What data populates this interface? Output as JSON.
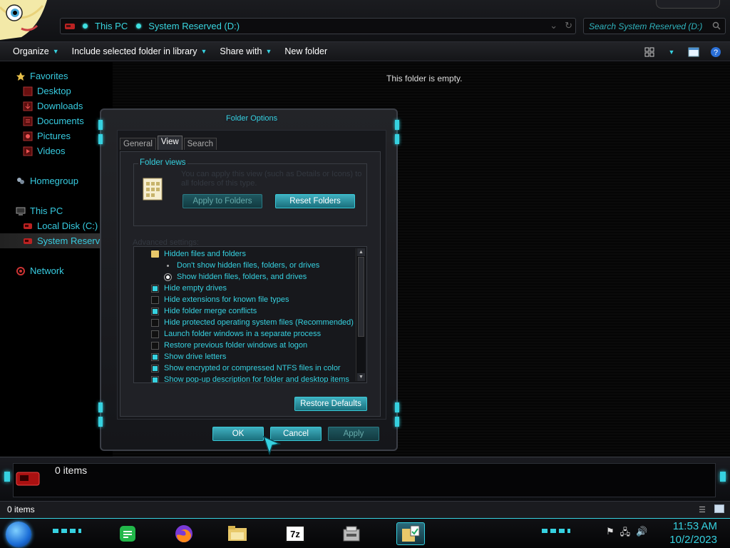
{
  "address": {
    "crumbs": [
      "This PC",
      "System Reserved (D:)"
    ],
    "search_placeholder": "Search System Reserved (D:)"
  },
  "toolbar": {
    "organize": "Organize",
    "include": "Include selected folder in library",
    "share": "Share with",
    "new_folder": "New folder"
  },
  "nav": {
    "favorites": "Favorites",
    "desktop": "Desktop",
    "downloads": "Downloads",
    "documents": "Documents",
    "pictures": "Pictures",
    "videos": "Videos",
    "homegroup": "Homegroup",
    "this_pc": "This PC",
    "local_disk": "Local Disk (C:)",
    "system_reserved": "System Reserve",
    "network": "Network"
  },
  "content": {
    "empty_message": "This folder is empty."
  },
  "details": {
    "item_count": "0 items"
  },
  "status": {
    "item_count": "0 items"
  },
  "dialog": {
    "title": "Folder Options",
    "tabs": [
      "General",
      "View",
      "Search"
    ],
    "active_tab": "View",
    "folder_views": {
      "legend": "Folder views",
      "description": "You can apply this view (such as Details or Icons) to all folders of this type.",
      "apply_button": "Apply to Folders",
      "reset_button": "Reset Folders"
    },
    "advanced_label": "Advanced settings:",
    "settings": [
      {
        "label": "Hidden files and folders",
        "kind": "folder"
      },
      {
        "label": "Don't show hidden files, folders, or drives",
        "kind": "radio",
        "checked": false
      },
      {
        "label": "Show hidden files, folders, and drives",
        "kind": "radio",
        "checked": true
      },
      {
        "label": "Hide empty drives",
        "kind": "checkbox",
        "checked": true
      },
      {
        "label": "Hide extensions for known file types",
        "kind": "checkbox",
        "checked": false
      },
      {
        "label": "Hide folder merge conflicts",
        "kind": "checkbox",
        "checked": true
      },
      {
        "label": "Hide protected operating system files (Recommended)",
        "kind": "checkbox",
        "checked": false
      },
      {
        "label": "Launch folder windows in a separate process",
        "kind": "checkbox",
        "checked": false
      },
      {
        "label": "Restore previous folder windows at logon",
        "kind": "checkbox",
        "checked": false
      },
      {
        "label": "Show drive letters",
        "kind": "checkbox",
        "checked": true
      },
      {
        "label": "Show encrypted or compressed NTFS files in color",
        "kind": "checkbox",
        "checked": true
      },
      {
        "label": "Show pop-up description for folder and desktop items",
        "kind": "checkbox",
        "checked": true
      }
    ],
    "restore_defaults": "Restore Defaults",
    "ok": "OK",
    "cancel": "Cancel",
    "apply": "Apply"
  },
  "taskbar": {
    "apps": [
      "notes-app-icon",
      "firefox-icon",
      "file-explorer-icon",
      "7zip-icon",
      "drive-tool-icon",
      "folder-options-icon"
    ],
    "seven_zip_label": "7z",
    "time": "11:53 AM",
    "date": "10/2/2023"
  },
  "colors": {
    "accent": "#36d1e0",
    "background": "#000000",
    "button": "#1a6f7c"
  }
}
